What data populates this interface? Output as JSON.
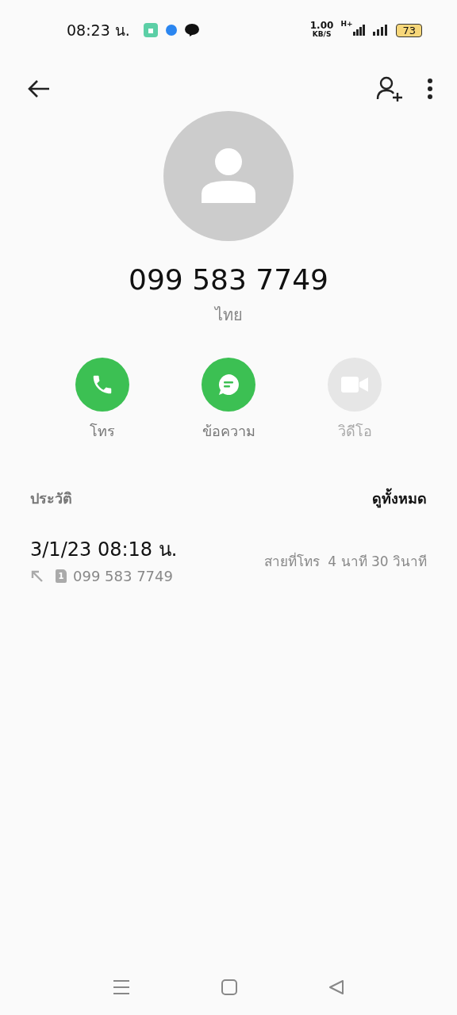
{
  "status_bar": {
    "time": "08:23 น.",
    "net_speed": "1.00",
    "net_unit": "KB/S",
    "net_type": "H+",
    "battery": "73"
  },
  "contact": {
    "number": "099 583 7749",
    "location": "ไทย"
  },
  "actions": [
    {
      "kind": "call",
      "label": "โทร",
      "disabled": false
    },
    {
      "kind": "message",
      "label": "ข้อความ",
      "disabled": false
    },
    {
      "kind": "video",
      "label": "วิดีโอ",
      "disabled": true
    }
  ],
  "history": {
    "title": "ประวัติ",
    "view_all": "ดูทั้งหมด",
    "entries": [
      {
        "date": "3/1/23 08:18 น.",
        "sim": "1",
        "number": "099 583 7749",
        "type": "สายที่โทร",
        "duration": "4 นาที 30 วินาที"
      }
    ]
  }
}
